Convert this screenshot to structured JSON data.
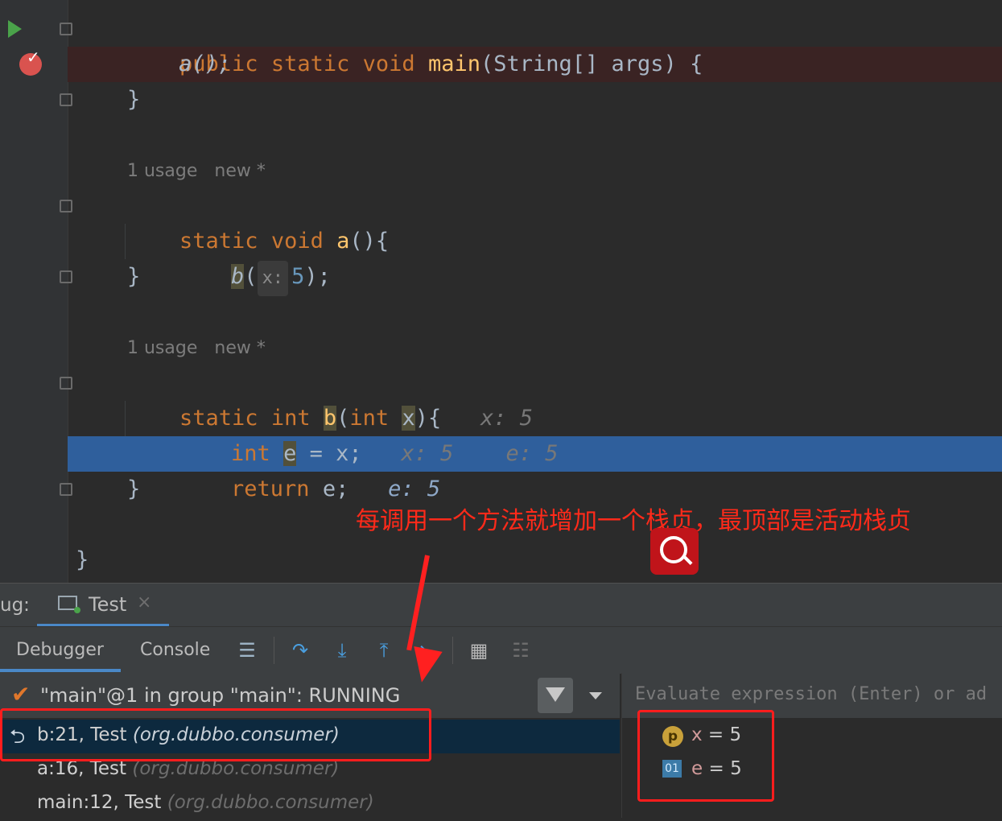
{
  "editor": {
    "lines": {
      "main_sig": {
        "kw1": "public",
        "kw2": "static",
        "kw3": "void",
        "fn": "main",
        "rest": "(String[] args) {"
      },
      "main_call": {
        "text": "a();"
      },
      "brace1": "}",
      "a_meta": {
        "usage": "1 usage",
        "new": "new *"
      },
      "a_sig": {
        "kw1": "static",
        "kw2": "void",
        "fn": "a",
        "rest": "(){"
      },
      "a_body": {
        "call": "b",
        "open": "(",
        "hint": "x:",
        "arg": "5",
        "close": ");"
      },
      "brace2": "}",
      "b_meta": {
        "usage": "1 usage",
        "new": "new *"
      },
      "b_sig": {
        "kw1": "static",
        "kw2": "int",
        "fn": "b",
        "open": "(",
        "kw3": "int",
        "param": "x",
        "close": "){",
        "inline": "x: 5"
      },
      "b_line1": {
        "kw": "int",
        "var": "e",
        "rest": " = x;",
        "inline1": "x: 5",
        "inline2": "e: 5"
      },
      "b_line2": {
        "kw": "return",
        "rest": " e;",
        "inline": "e: 5"
      },
      "brace3": "}",
      "brace4": "}"
    }
  },
  "annotation": "每调用一个方法就增加一个栈贞，最顶部是活动栈贞",
  "tool_window": {
    "debug_label": "ug:",
    "session_tab": "Test",
    "session_close": "×",
    "tabs": {
      "debugger": "Debugger",
      "console": "Console"
    }
  },
  "thread": {
    "text": "\"main\"@1 in group \"main\": RUNNING"
  },
  "frames": [
    {
      "name": "b:21, Test",
      "pkg": "(org.dubbo.consumer)"
    },
    {
      "name": "a:16, Test",
      "pkg": "(org.dubbo.consumer)"
    },
    {
      "name": "main:12, Test",
      "pkg": "(org.dubbo.consumer)"
    }
  ],
  "evaluate": {
    "placeholder": "Evaluate expression (Enter) or ad"
  },
  "variables": [
    {
      "icon": "p",
      "name": "x",
      "eq": " = ",
      "value": "5"
    },
    {
      "icon": "01",
      "name": "e",
      "eq": " = ",
      "value": "5"
    }
  ],
  "colors": {
    "accent": "#4a88c7",
    "breakpoint": "#d9534f",
    "annotation": "#ff2a1a",
    "exec_line": "#2f5f9c"
  }
}
